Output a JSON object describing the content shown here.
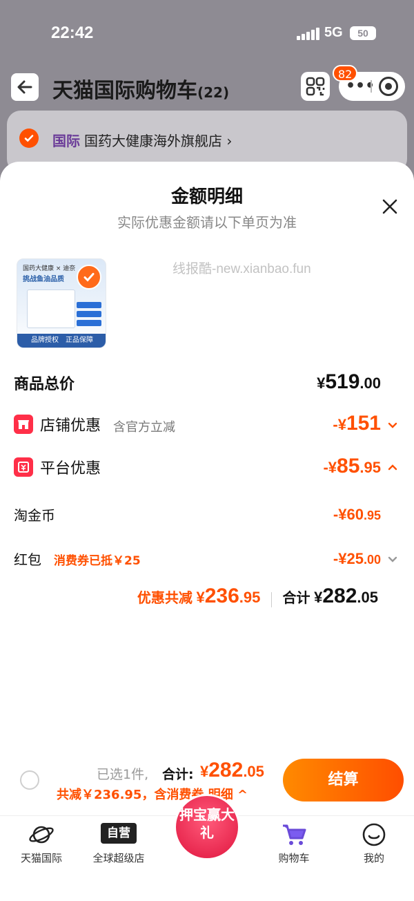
{
  "status_bar": {
    "time": "22:42",
    "network": "5G",
    "battery": "50"
  },
  "background": {
    "title": "天猫国际购物车",
    "count": "(22)",
    "notification_badge": "82",
    "store": {
      "tag": "国际",
      "name": "国药大健康海外旗舰店 ›"
    }
  },
  "sheet": {
    "title": "金额明细",
    "subtitle": "实际优惠金额请以下单页为准",
    "watermark": "线报酷-new.xianbao.fun",
    "product": {
      "brand": "国药大健康 × 迪奈",
      "claim": "挑战鱼油品质",
      "footer": "品牌授权　正品保障"
    },
    "rows": {
      "total": {
        "label": "商品总价",
        "yen": "¥",
        "int": "519",
        "dec": ".00"
      },
      "store_discount": {
        "label": "店铺优惠",
        "note": "含官方立减",
        "prefix": "-¥",
        "int": "151",
        "dec": ""
      },
      "platform_discount": {
        "label": "平台优惠",
        "prefix": "-¥",
        "int": "85",
        "dec": ".95"
      },
      "taojin": {
        "label": "淘金币",
        "prefix": "-¥",
        "int": "60",
        "dec": ".95"
      },
      "redpacket": {
        "label": "红包",
        "note": "消费券已抵￥25",
        "prefix": "-¥",
        "int": "25",
        "dec": ".00"
      }
    },
    "summary": {
      "saved_label": "优惠共减",
      "saved_yen": "¥",
      "saved_int": "236",
      "saved_dec": ".95",
      "sum_label": "合计",
      "sum_yen": "¥",
      "sum_int": "282",
      "sum_dec": ".05"
    }
  },
  "checkout": {
    "selected": "已选1件,",
    "total_label": "合计:",
    "total_yen": "¥",
    "total_int": "282",
    "total_dec": ".05",
    "saving": "共减￥236.95，含消费券 明细 ^",
    "button": "结算"
  },
  "tabs": [
    {
      "label": "天猫国际"
    },
    {
      "label": "全球超级店",
      "icon_text": "自营"
    },
    {
      "label": "押宝赢大礼"
    },
    {
      "label": "购物车"
    },
    {
      "label": "我的"
    }
  ],
  "colors": {
    "accent": "#ff5000",
    "platform_purple": "#6a3b98"
  }
}
